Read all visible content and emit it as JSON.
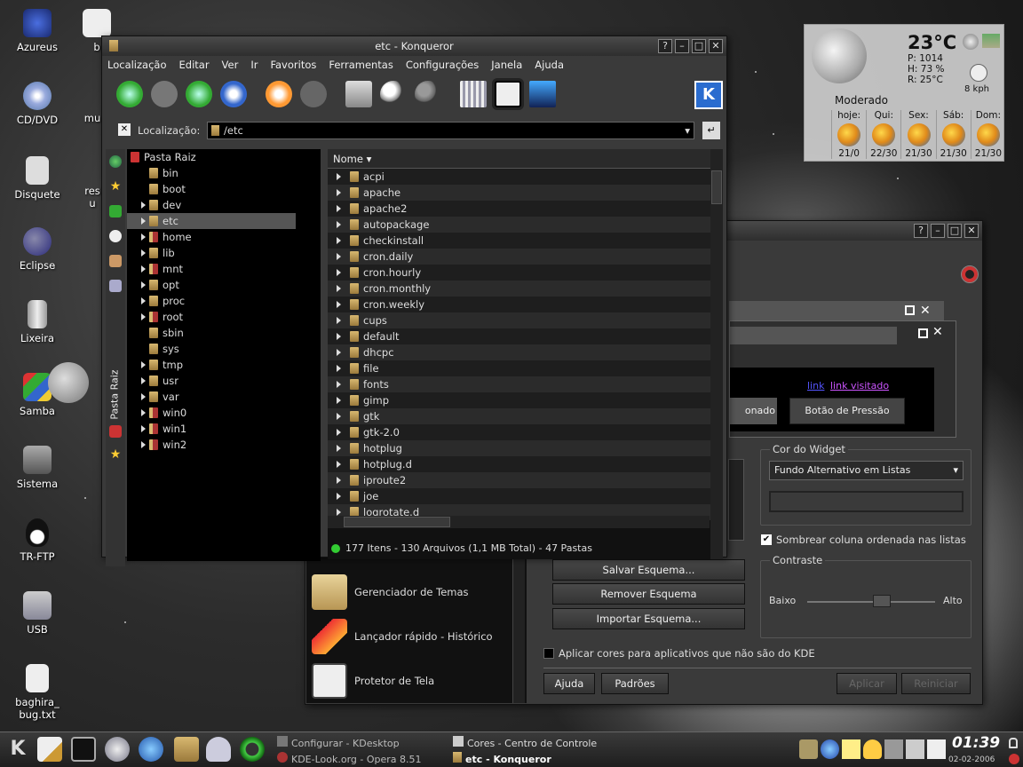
{
  "desktop": {
    "icons": [
      "Azureus",
      "b",
      "CD/DVD",
      "mu",
      "Disquete",
      "res",
      "u",
      "Eclipse",
      "Lixeira",
      "Samba",
      "Sistema",
      "TR-FTP",
      "USB",
      "baghira_",
      "bug.txt"
    ]
  },
  "weather": {
    "temperature": "23°C",
    "pressure": "P: 1014",
    "humidity": "H: 73 %",
    "dew": "R: 25°C",
    "wind": "8 kph",
    "condition": "Moderado",
    "days": [
      {
        "label": "hoje:",
        "temp": "21/0"
      },
      {
        "label": "Qui:",
        "temp": "22/30"
      },
      {
        "label": "Sex:",
        "temp": "21/30"
      },
      {
        "label": "Sáb:",
        "temp": "21/30"
      },
      {
        "label": "Dom:",
        "temp": "21/30"
      }
    ]
  },
  "konqueror": {
    "title": "etc - Konqueror",
    "menu": [
      "Localização",
      "Editar",
      "Ver",
      "Ir",
      "Favoritos",
      "Ferramentas",
      "Configurações",
      "Janela",
      "Ajuda"
    ],
    "location_label": "Localização:",
    "location_value": "/etc",
    "sidebar_label": "Pasta Raiz",
    "tree_root": "Pasta Raiz",
    "tree": [
      "bin",
      "boot",
      "dev",
      "etc",
      "home",
      "lib",
      "mnt",
      "opt",
      "proc",
      "root",
      "sbin",
      "sys",
      "tmp",
      "usr",
      "var",
      "win0",
      "win1",
      "win2"
    ],
    "column_header": "Nome",
    "files": [
      "acpi",
      "apache",
      "apache2",
      "autopackage",
      "checkinstall",
      "cron.daily",
      "cron.hourly",
      "cron.monthly",
      "cron.weekly",
      "cups",
      "default",
      "dhcpc",
      "file",
      "fonts",
      "gimp",
      "gtk",
      "gtk-2.0",
      "hotplug",
      "hotplug.d",
      "iproute2",
      "joe",
      "logrotate.d"
    ],
    "status": "177 Itens - 130 Arquivos (1,1 MB Total) - 47 Pastas"
  },
  "control_center": {
    "preview_link": "link",
    "preview_visited": "link visitado",
    "preview_selected": "onado",
    "preview_button": "Botão de Pressão",
    "widget_color_group": "Cor do Widget",
    "widget_color_select": "Fundo Alternativo em Listas",
    "shade_checkbox": "Sombrear coluna ordenada nas listas",
    "contrast_group": "Contraste",
    "contrast_low": "Baixo",
    "contrast_high": "Alto",
    "contrast_level": 0.6,
    "save_scheme": "Salvar Esquema...",
    "remove_scheme": "Remover Esquema",
    "import_scheme": "Importar Esquema...",
    "apply_non_kde": "Aplicar cores para aplicativos que não são do KDE",
    "help": "Ajuda",
    "defaults": "Padrões",
    "apply": "Aplicar",
    "reset": "Reiniciar",
    "modules": [
      "Gerenciador de Temas",
      "Lançador rápido - Histórico",
      "Protetor de Tela"
    ]
  },
  "taskbar": {
    "tasks": [
      "Configurar - KDesktop",
      "KDE-Look.org - Opera 8.51",
      "Cores - Centro de Controle",
      "etc - Konqueror"
    ],
    "clock": "01:39",
    "date": "02-02-2006"
  }
}
